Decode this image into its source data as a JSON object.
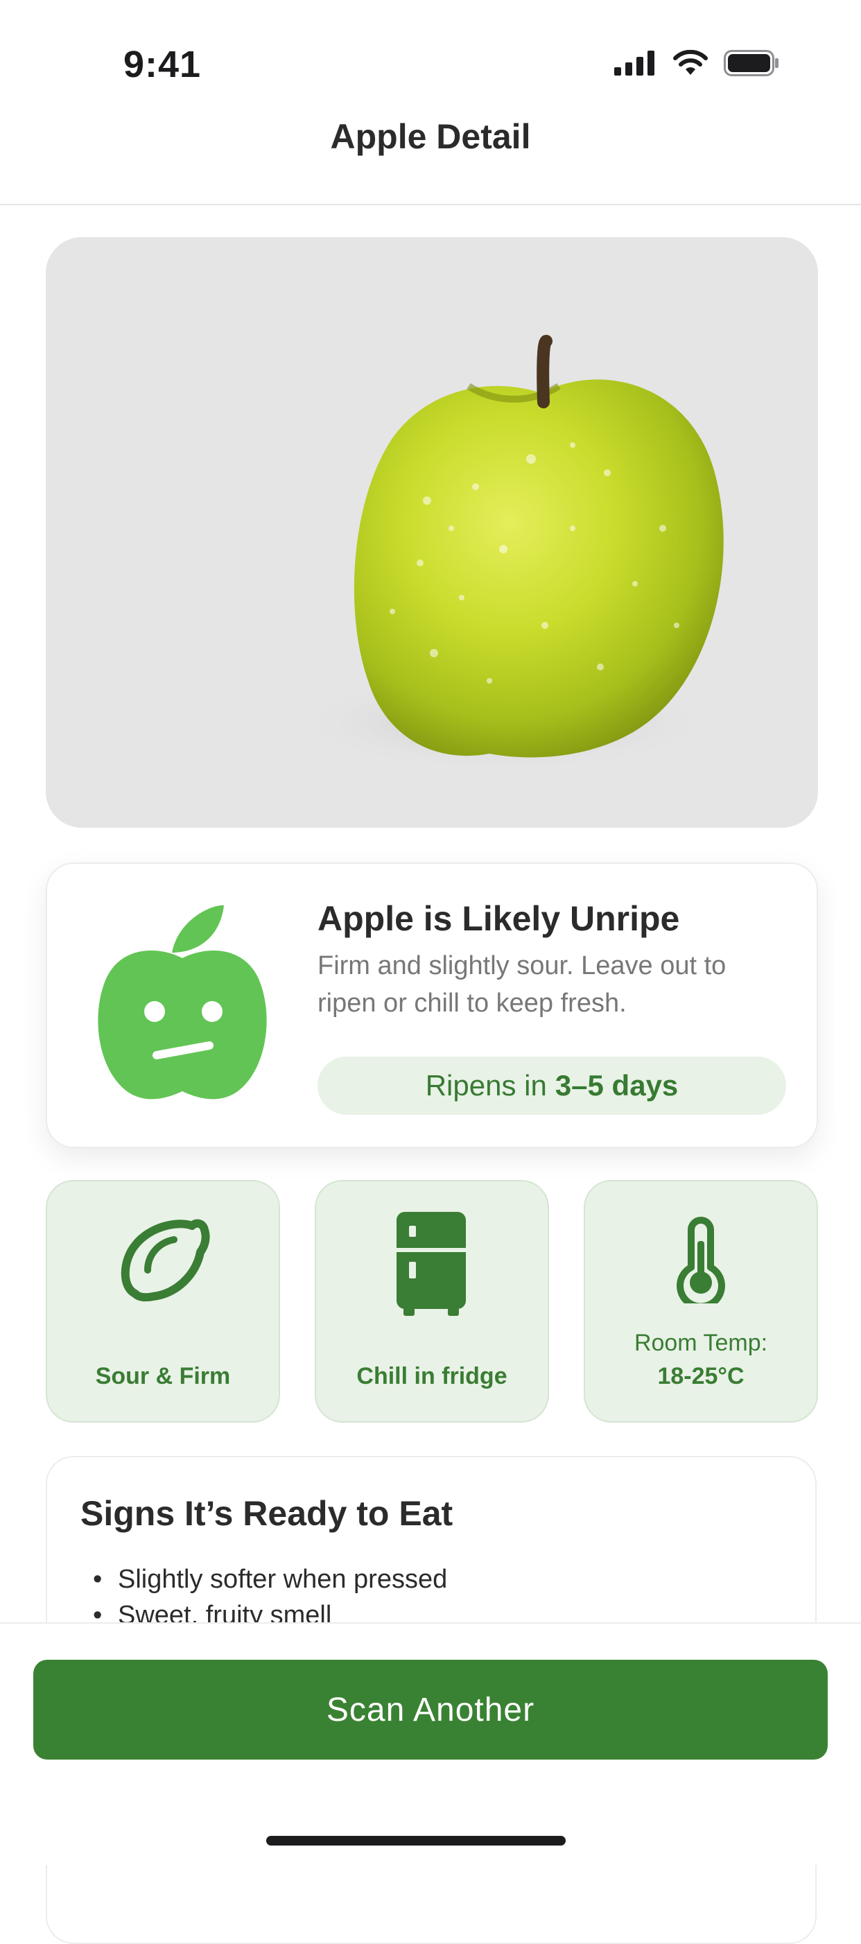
{
  "status_bar": {
    "time": "9:41",
    "icons": [
      "cellular-signal-icon",
      "wifi-icon",
      "battery-icon"
    ]
  },
  "nav": {
    "title": "Apple Detail"
  },
  "hero": {
    "image": "green-apple-photo"
  },
  "ripeness": {
    "title": "Apple is Likely Unripe",
    "description": "Firm and slightly sour. Leave out to ripen or chill to keep fresh.",
    "pill_prefix": "Ripens in",
    "pill_value": "3–5 days",
    "icon": "unripe-apple-face-icon"
  },
  "tiles": [
    {
      "icon": "lemon-icon",
      "label": "Sour & Firm"
    },
    {
      "icon": "fridge-icon",
      "label": "Chill in fridge"
    },
    {
      "icon": "thermometer-icon",
      "label_line1": "Room Temp:",
      "label_line2": "18-25°C"
    }
  ],
  "signs": {
    "title": "Signs It’s Ready to Eat",
    "items": [
      "Slightly softer when pressed",
      "Sweet, fruity smell"
    ]
  },
  "cta": {
    "label": "Scan Another"
  },
  "colors": {
    "accent": "#3a8233",
    "accent_light": "#e9f2e7",
    "apple_icon": "#62c454"
  }
}
